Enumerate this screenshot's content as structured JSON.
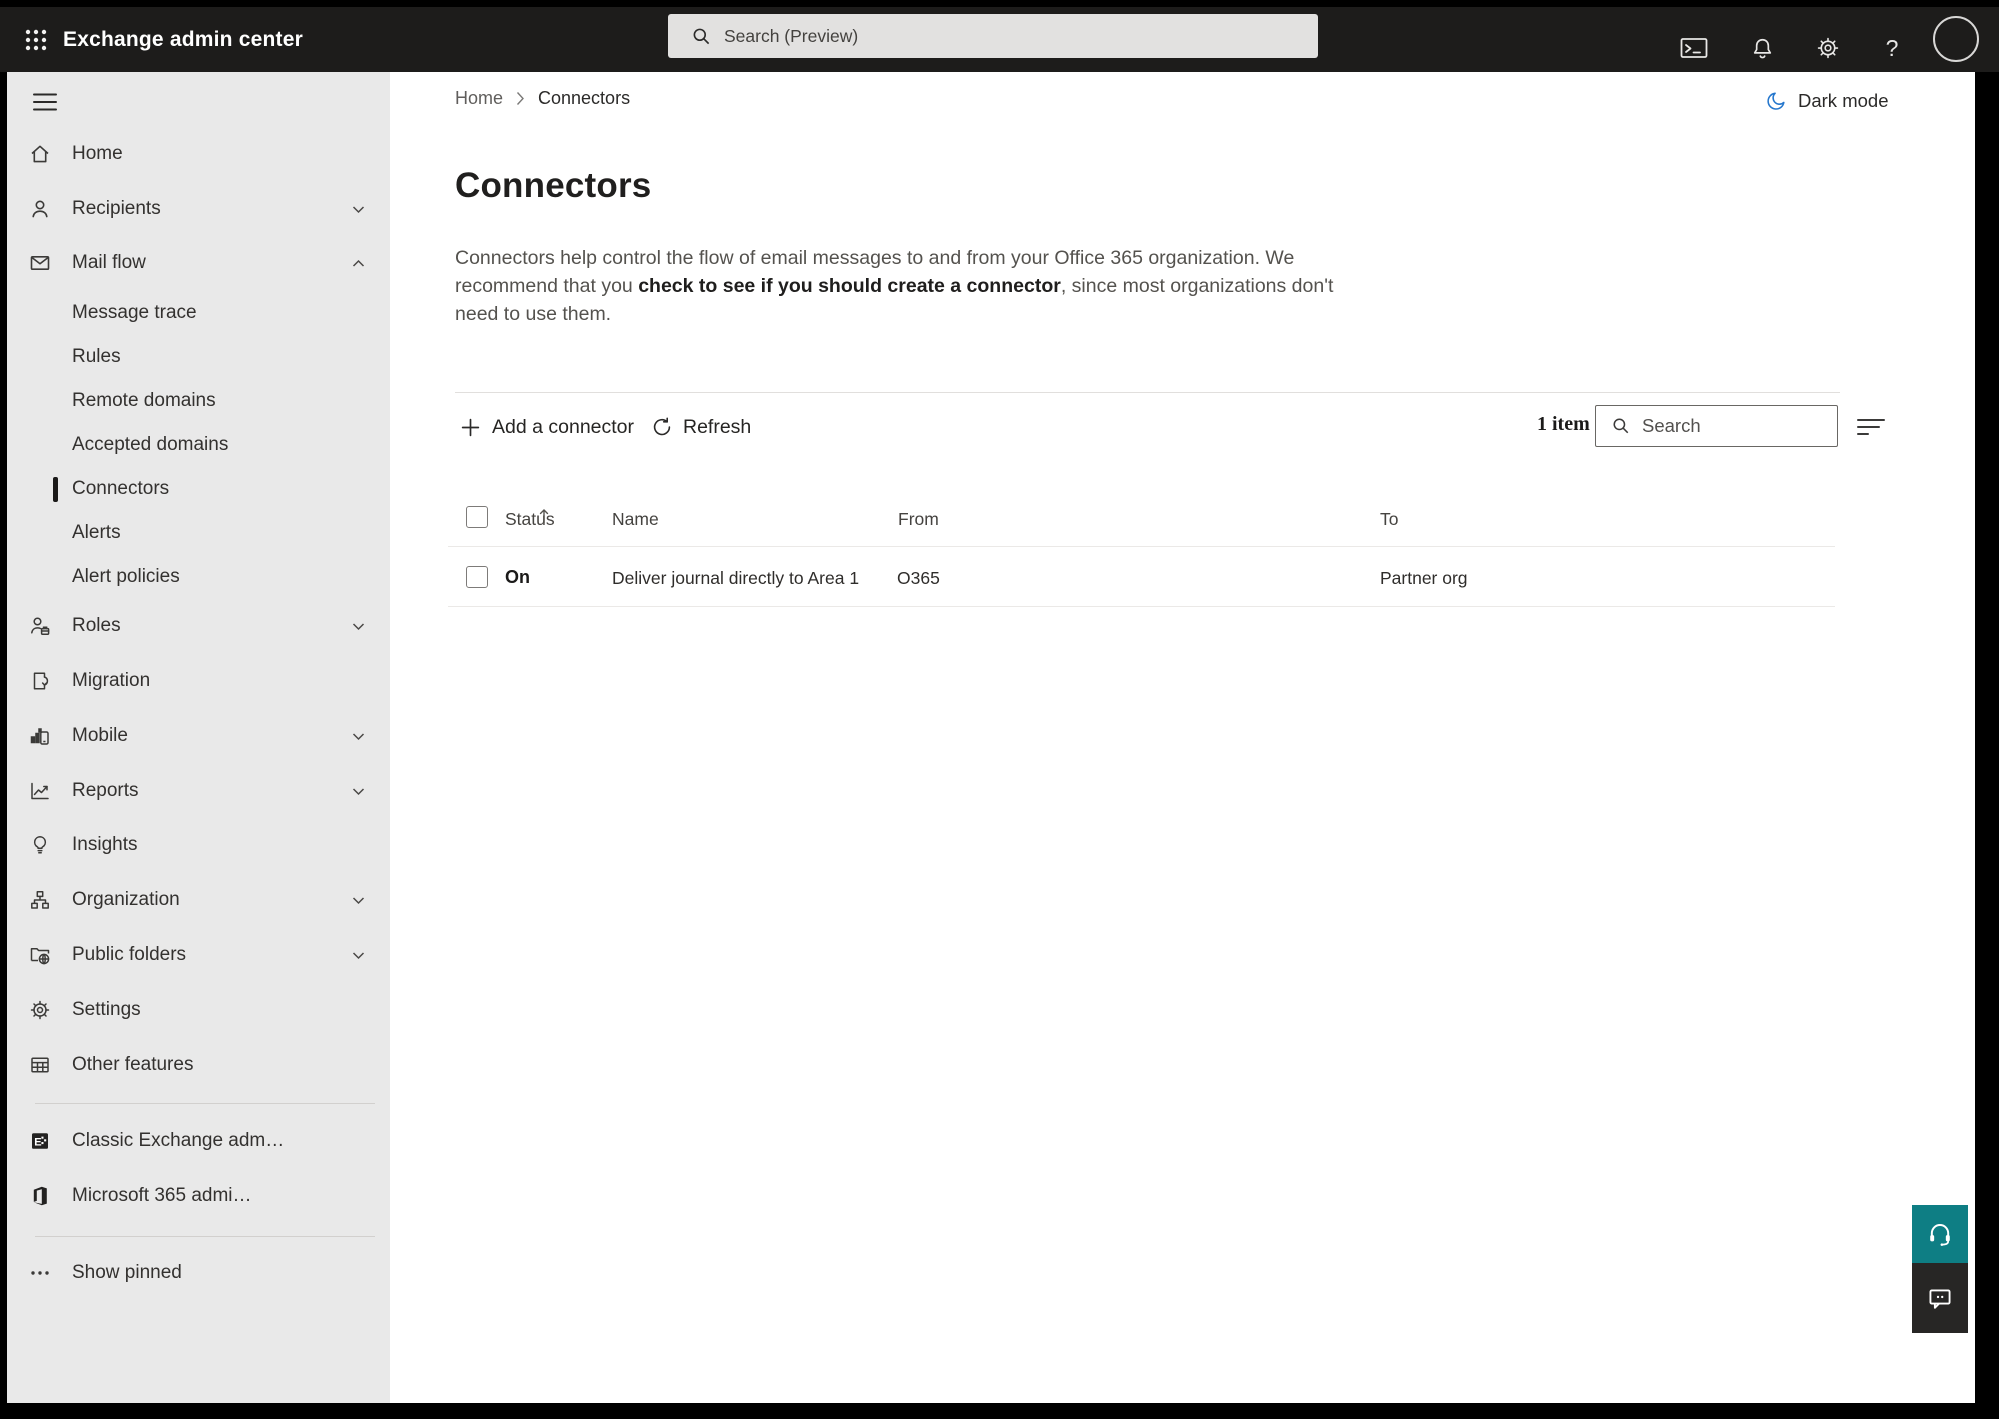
{
  "topbar": {
    "title": "Exchange admin center",
    "search_placeholder": "Search (Preview)",
    "help_glyph": "?",
    "icons": [
      "app-launcher",
      "terminal",
      "notifications",
      "settings",
      "help",
      "account"
    ]
  },
  "header": {
    "breadcrumb": [
      "Home",
      "Connectors"
    ],
    "dark_mode_label": "Dark mode",
    "dark_mode_icon": "moon-icon"
  },
  "sidebar": {
    "items": [
      {
        "label": "Home",
        "icon": "home"
      },
      {
        "label": "Recipients",
        "icon": "person",
        "chevron": "down"
      },
      {
        "label": "Mail flow",
        "icon": "mail",
        "chevron": "up",
        "expanded": true
      },
      {
        "label": "Message trace",
        "type": "sub"
      },
      {
        "label": "Rules",
        "type": "sub"
      },
      {
        "label": "Remote domains",
        "type": "sub"
      },
      {
        "label": "Accepted domains",
        "type": "sub"
      },
      {
        "label": "Connectors",
        "type": "sub",
        "selected": true
      },
      {
        "label": "Alerts",
        "type": "sub"
      },
      {
        "label": "Alert policies",
        "type": "sub"
      },
      {
        "label": "Roles",
        "icon": "person-briefcase",
        "chevron": "down"
      },
      {
        "label": "Migration",
        "icon": "document-arrow"
      },
      {
        "label": "Mobile",
        "icon": "chart-phone",
        "chevron": "down"
      },
      {
        "label": "Reports",
        "icon": "line-chart",
        "chevron": "down"
      },
      {
        "label": "Insights",
        "icon": "lightbulb"
      },
      {
        "label": "Organization",
        "icon": "org-chart",
        "chevron": "down"
      },
      {
        "label": "Public folders",
        "icon": "folder-globe",
        "chevron": "down"
      },
      {
        "label": "Settings",
        "icon": "gear"
      },
      {
        "label": "Other features",
        "icon": "grid-table"
      },
      {
        "label": "Classic Exchange adm…",
        "icon": "exchange-logo"
      },
      {
        "label": "Microsoft 365 admi…",
        "icon": "microsoft365-logo"
      },
      {
        "label": "Show pinned",
        "icon": "ellipsis"
      }
    ]
  },
  "page": {
    "title": "Connectors",
    "description_part1": "Connectors help control the flow of email messages to and from your Office 365 organization. We recommend that you ",
    "description_emphasis": "check to see if you should create a connector",
    "description_part2": ", since most organizations don't need to use them."
  },
  "toolbar": {
    "add_button": "Add a connector",
    "refresh_button": "Refresh",
    "item_count": "1 item",
    "search_placeholder": "Search"
  },
  "table": {
    "headers": [
      "Status",
      "Name",
      "From",
      "To"
    ],
    "sort": {
      "column": "Status",
      "direction": "ascending"
    },
    "rows": [
      {
        "status": "On",
        "name": "Deliver journal directly to Area 1",
        "from": "O365",
        "to": "Partner org"
      }
    ]
  },
  "floating_buttons": {
    "support_icon": "headset-icon",
    "feedback_icon": "chat-icon"
  },
  "colors": {
    "topbar_bg": "#1d1c1b",
    "sidebar_bg": "#e9e9e9",
    "selected_indicator": "#1b1a19",
    "moon_blue": "#2577cd",
    "teal_support": "#0e7e84",
    "feedback_dark": "#272625"
  }
}
